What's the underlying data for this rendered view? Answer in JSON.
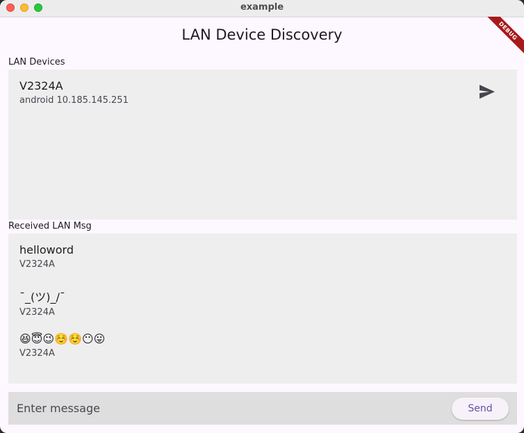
{
  "window": {
    "title": "example",
    "debug_banner": "DEBUG"
  },
  "app": {
    "title": "LAN Device Discovery"
  },
  "devices_section": {
    "label": "LAN Devices",
    "devices": [
      {
        "name": "V2324A",
        "info": "android 10.185.145.251",
        "action_icon": "send-icon"
      }
    ]
  },
  "messages_section": {
    "label": "Received LAN Msg",
    "messages": [
      {
        "text": "helloword",
        "from": "V2324A"
      },
      {
        "text": "¯_(ツ)_/¯",
        "from": "V2324A"
      },
      {
        "text": "😆😇😉☺️☺️😶😛",
        "from": "V2324A"
      }
    ]
  },
  "composer": {
    "placeholder": "Enter message",
    "value": "",
    "send_label": "Send"
  },
  "colors": {
    "background": "#fdf7ff",
    "panel": "#eeeeee",
    "input_bar": "#dedede",
    "accent": "#6750a4"
  }
}
